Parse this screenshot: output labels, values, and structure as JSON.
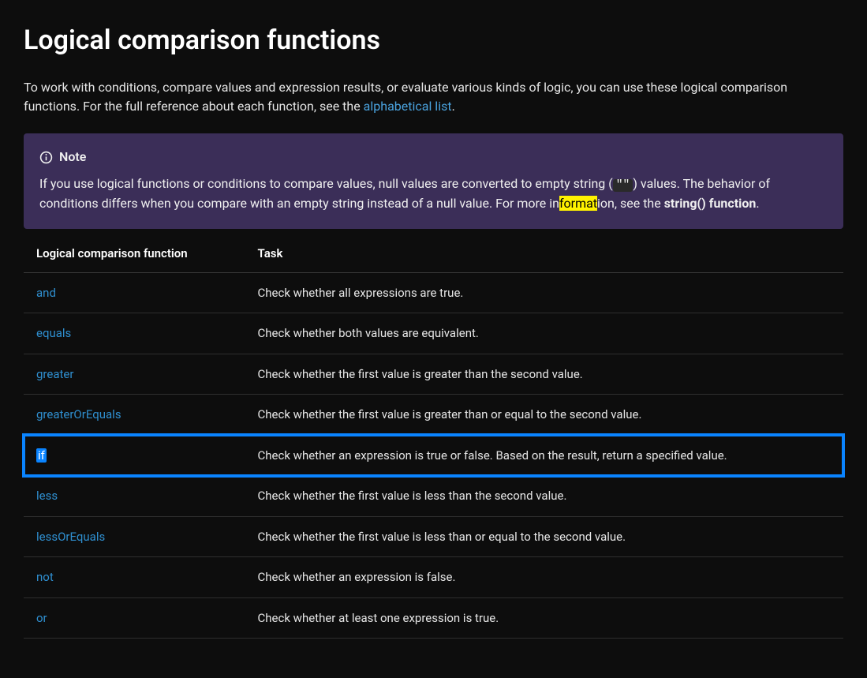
{
  "heading": "Logical comparison functions",
  "intro": {
    "text_before_link": "To work with conditions, compare values and expression results, or evaluate various kinds of logic, you can use these logical comparison functions. For the full reference about each function, see the ",
    "link_text": "alphabetical list",
    "text_after_link": "."
  },
  "note": {
    "label": "Note",
    "body_part1": "If you use logical functions or conditions to compare values, null values are converted to empty string (",
    "body_code": "\"\"",
    "body_part2": ") values. The behavior of conditions differs when you compare with an empty string instead of a null value. For more in",
    "body_highlight": "format",
    "body_part3": "ion, see the ",
    "body_strong_link": "string() function",
    "body_part4": "."
  },
  "table": {
    "headers": {
      "col1": "Logical comparison function",
      "col2": "Task"
    },
    "rows": [
      {
        "name": "and",
        "task": "Check whether all expressions are true.",
        "selected": false
      },
      {
        "name": "equals",
        "task": "Check whether both values are equivalent.",
        "selected": false
      },
      {
        "name": "greater",
        "task": "Check whether the first value is greater than the second value.",
        "selected": false
      },
      {
        "name": "greaterOrEquals",
        "task": "Check whether the first value is greater than or equal to the second value.",
        "selected": false
      },
      {
        "name": "if",
        "task": "Check whether an expression is true or false. Based on the result, return a specified value.",
        "selected": true
      },
      {
        "name": "less",
        "task": "Check whether the first value is less than the second value.",
        "selected": false
      },
      {
        "name": "lessOrEquals",
        "task": "Check whether the first value is less than or equal to the second value.",
        "selected": false
      },
      {
        "name": "not",
        "task": "Check whether an expression is false.",
        "selected": false
      },
      {
        "name": "or",
        "task": "Check whether at least one expression is true.",
        "selected": false
      }
    ]
  }
}
